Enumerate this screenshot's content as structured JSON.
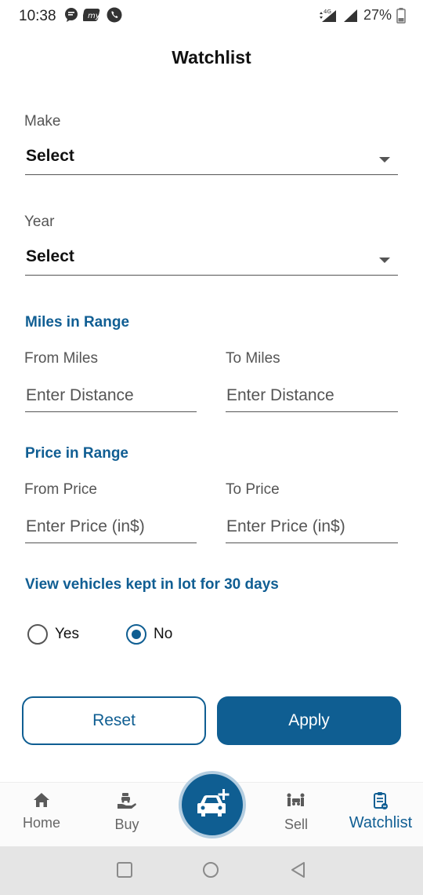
{
  "status": {
    "time": "10:38",
    "battery": "27%"
  },
  "page": {
    "title": "Watchlist"
  },
  "make": {
    "label": "Make",
    "value": "Select"
  },
  "year": {
    "label": "Year",
    "value": "Select"
  },
  "miles": {
    "heading": "Miles in Range",
    "from_label": "From Miles",
    "to_label": "To Miles",
    "from_placeholder": "Enter Distance",
    "to_placeholder": "Enter Distance"
  },
  "price": {
    "heading": "Price in Range",
    "from_label": "From Price",
    "to_label": "To Price",
    "from_placeholder": "Enter Price (in$)",
    "to_placeholder": "Enter Price (in$)"
  },
  "lot": {
    "heading": "View vehicles kept in lot for 30 days",
    "options": [
      {
        "label": "Yes",
        "selected": false
      },
      {
        "label": "No",
        "selected": true
      }
    ]
  },
  "actions": {
    "reset": "Reset",
    "apply": "Apply"
  },
  "nav": {
    "items": [
      {
        "label": "Home",
        "icon": "home-icon"
      },
      {
        "label": "Buy",
        "icon": "buy-icon"
      },
      {
        "label": "Sell",
        "icon": "sell-icon"
      },
      {
        "label": "Watchlist",
        "icon": "watchlist-icon",
        "active": true
      }
    ],
    "fab_icon": "add-car-icon"
  },
  "colors": {
    "primary": "#0f5e92",
    "accent_text": "#105e93"
  }
}
